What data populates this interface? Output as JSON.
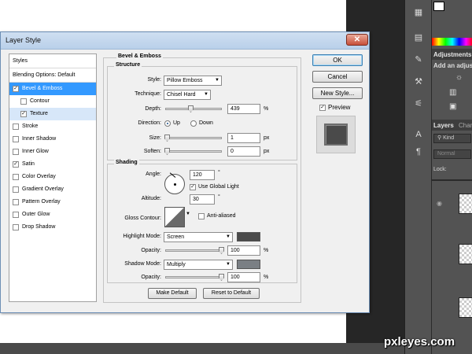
{
  "dialog": {
    "title": "Layer Style"
  },
  "styles_list": {
    "header": "Styles",
    "blending_options": "Blending Options: Default",
    "items": [
      {
        "label": "Bevel & Emboss",
        "checked": true
      },
      {
        "label": "Contour",
        "checked": false
      },
      {
        "label": "Texture",
        "checked": true
      },
      {
        "label": "Stroke",
        "checked": false
      },
      {
        "label": "Inner Shadow",
        "checked": false
      },
      {
        "label": "Inner Glow",
        "checked": false
      },
      {
        "label": "Satin",
        "checked": true
      },
      {
        "label": "Color Overlay",
        "checked": false
      },
      {
        "label": "Gradient Overlay",
        "checked": false
      },
      {
        "label": "Pattern Overlay",
        "checked": false
      },
      {
        "label": "Outer Glow",
        "checked": false
      },
      {
        "label": "Drop Shadow",
        "checked": false
      }
    ]
  },
  "bevel": {
    "title": "Bevel & Emboss",
    "structure_title": "Structure",
    "style_label": "Style:",
    "style_value": "Pillow Emboss",
    "technique_label": "Technique:",
    "technique_value": "Chisel Hard",
    "depth_label": "Depth:",
    "depth_value": "439",
    "depth_unit": "%",
    "direction_label": "Direction:",
    "dir_up": "Up",
    "dir_down": "Down",
    "size_label": "Size:",
    "size_value": "1",
    "size_unit": "px",
    "soften_label": "Soften:",
    "soften_value": "0",
    "soften_unit": "px"
  },
  "shading": {
    "title": "Shading",
    "angle_label": "Angle:",
    "angle_value": "120",
    "angle_unit": "°",
    "global_light": "Use Global Light",
    "altitude_label": "Altitude:",
    "altitude_value": "30",
    "altitude_unit": "°",
    "gloss_label": "Gloss Contour:",
    "anti_aliased": "Anti-aliased",
    "highlight_label": "Highlight Mode:",
    "highlight_value": "Screen",
    "highlight_color": "#4a4a4a",
    "hl_opacity_label": "Opacity:",
    "hl_opacity_value": "100",
    "hl_opacity_unit": "%",
    "shadow_label": "Shadow Mode:",
    "shadow_value": "Multiply",
    "shadow_color": "#7a7f84",
    "sh_opacity_label": "Opacity:",
    "sh_opacity_value": "100",
    "sh_opacity_unit": "%"
  },
  "buttons": {
    "ok": "OK",
    "cancel": "Cancel",
    "new_style": "New Style...",
    "preview": "Preview",
    "make_default": "Make Default",
    "reset_default": "Reset to Default"
  },
  "ps_panels": {
    "adjustments": "Adjustments",
    "add_adjust": "Add an adjus",
    "layers_tab": "Layers",
    "channels_tab": "Chan",
    "kind": "Kind",
    "blend": "Normal",
    "lock": "Lock:"
  },
  "watermark": "pxleyes.com"
}
